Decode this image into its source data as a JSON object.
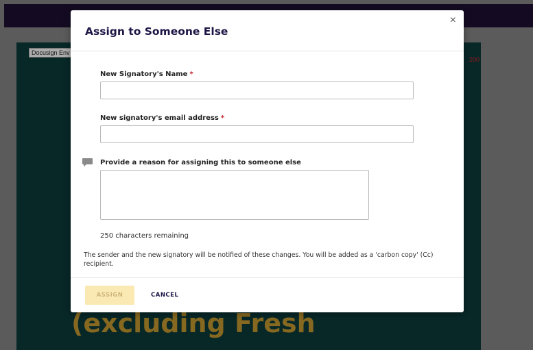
{
  "background": {
    "doc_tag": "Docusign Env",
    "doc_red_text": "200",
    "doc_big_text": "(excluding Fresh"
  },
  "modal": {
    "title": "Assign to Someone Else",
    "close_glyph": "×",
    "name_label": "New Signatory's Name",
    "email_label": "New signatory's email address",
    "required_mark": "*",
    "name_value": "",
    "email_value": "",
    "reason_label": "Provide a reason for assigning this to someone else",
    "reason_value": "",
    "chars_remaining": "250 characters remaining",
    "notice": "The sender and the new signatory will be notified of these changes. You will be added as a 'carbon copy' (Cc) recipient.",
    "assign_label": "ASSIGN",
    "cancel_label": "CANCEL"
  },
  "colors": {
    "title": "#1e1545",
    "required": "#c8242b",
    "assign_disabled_bg": "#fbe9b4",
    "doc_bg": "#0b3535"
  },
  "icons": {
    "comment": "comment-icon",
    "close": "close-icon"
  }
}
